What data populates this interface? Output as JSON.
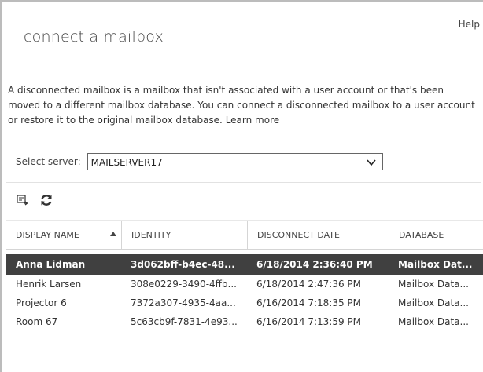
{
  "help_label": "Help",
  "title": "connect a mailbox",
  "description": {
    "text": "A disconnected mailbox is a mailbox that isn't associated with a user account or that's been moved to a different mailbox database. You can connect a disconnected mailbox to a user account or restore it to the original mailbox database.",
    "learn_more": "Learn more"
  },
  "server": {
    "label": "Select server:",
    "value": "MAILSERVER17"
  },
  "toolbar": {
    "icons": [
      "connect-icon",
      "refresh-icon"
    ]
  },
  "table": {
    "columns": [
      "DISPLAY NAME",
      "IDENTITY",
      "DISCONNECT DATE",
      "DATABASE"
    ],
    "sort_column": "DISPLAY NAME",
    "sort_direction": "ascending",
    "rows": [
      {
        "name": "Anna Lidman",
        "identity": "3d062bff-b4ec-48...",
        "date": "6/18/2014 2:36:40 PM",
        "database": "Mailbox Dat...",
        "selected": true
      },
      {
        "name": "Henrik Larsen",
        "identity": "308e0229-3490-4ffb...",
        "date": "6/18/2014 2:47:36 PM",
        "database": "Mailbox Data...",
        "selected": false
      },
      {
        "name": "Projector 6",
        "identity": "7372a307-4935-4aa...",
        "date": "6/16/2014 7:18:35 PM",
        "database": "Mailbox Data...",
        "selected": false
      },
      {
        "name": "Room 67",
        "identity": "5c63cb9f-7831-4e93...",
        "date": "6/16/2014 7:13:59 PM",
        "database": "Mailbox Data...",
        "selected": false
      }
    ]
  }
}
